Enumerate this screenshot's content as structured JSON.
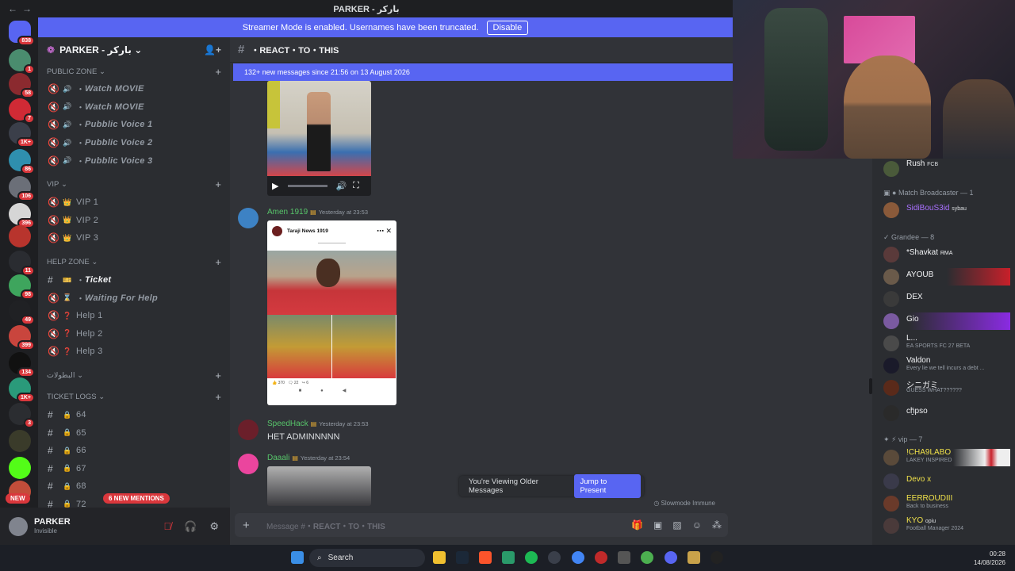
{
  "window": {
    "title": "PARKER - باركر"
  },
  "streamer": {
    "text": "Streamer Mode is enabled. Usernames have been truncated.",
    "disable_label": "Disable"
  },
  "servers": {
    "badges": [
      "838",
      "1",
      "58",
      "7",
      "1K+",
      "86",
      "106",
      "396",
      "11",
      "98",
      "49",
      "399",
      "134",
      "1K+",
      "3"
    ],
    "new_label": "NEW"
  },
  "guild": {
    "name": "PARKER - باركر"
  },
  "categories": {
    "public": "PUBLIC ZONE",
    "vip": "VIP",
    "help": "HELP ZONE",
    "arabic": "البطولات",
    "logs": "TICKET LOGS"
  },
  "public_channels": [
    {
      "emoji": "🔊",
      "name": "Watch MOVIE"
    },
    {
      "emoji": "🔊",
      "name": "Watch MOVIE"
    },
    {
      "emoji": "🔊",
      "name": "Pubblic Voice 1"
    },
    {
      "emoji": "🔊",
      "name": "Pubblic Voice 2"
    },
    {
      "emoji": "🔊",
      "name": "Pubblic Voice 3"
    }
  ],
  "vip_channels": [
    {
      "emoji": "👑",
      "name": "VIP 1"
    },
    {
      "emoji": "👑",
      "name": "VIP 2"
    },
    {
      "emoji": "👑",
      "name": "VIP 3"
    }
  ],
  "help_channels": [
    {
      "emoji": "🎫",
      "name": "Ticket"
    },
    {
      "emoji": "⌛",
      "name": "Waiting For Help"
    },
    {
      "emoji": "❓",
      "name": "Help 1"
    },
    {
      "emoji": "❓",
      "name": "Help 2"
    },
    {
      "emoji": "❓",
      "name": "Help 3"
    }
  ],
  "log_channels": [
    "64",
    "65",
    "66",
    "67",
    "68",
    "72"
  ],
  "mentions_label": "6 NEW MENTIONS",
  "user": {
    "name": "PARKER",
    "status": "Invisible"
  },
  "chat": {
    "channel": "・REACT・TO・THIS",
    "new_messages": "132+ new messages since 21:56 on 13 August 2026",
    "messages": [
      {
        "author": "Amen 1919",
        "time": "Yesterday at 23:53",
        "text": ""
      },
      {
        "author": "SpeedHack",
        "time": "Yesterday at 23:53",
        "text": "HET ADMINNNNN"
      },
      {
        "author": "Daaali",
        "time": "Yesterday at 23:54",
        "text": ""
      }
    ],
    "post": {
      "page": "Taraji News 1919",
      "likes": "370",
      "comments": "22",
      "shares": "6"
    },
    "older_text": "You're Viewing Older Messages",
    "jump_label": "Jump to Present",
    "slowmode": "Slowmode Immune",
    "composer_prefix": "Message #",
    "composer_channel": "・REACT・TO・THIS"
  },
  "members": {
    "top": {
      "name": "Rush",
      "tag": "FCB"
    },
    "group1": "Match Broadcaster — 1",
    "g1": [
      {
        "name": "SidiBouS3id",
        "tag": "sybau"
      }
    ],
    "group2": "Grandee — 8",
    "g2": [
      {
        "name": "*Shavkat",
        "tag": "RMA",
        "sub": ""
      },
      {
        "name": "AYOUB",
        "tag": "",
        "sub": ""
      },
      {
        "name": "DEX",
        "tag": "",
        "sub": ""
      },
      {
        "name": "Gio",
        "tag": "",
        "sub": ""
      },
      {
        "name": "L...",
        "tag": "",
        "sub": "EA SPORTS FC 27 BETA"
      },
      {
        "name": "Valdon",
        "tag": "",
        "sub": "Every lie we tell incurs a debt ..."
      },
      {
        "name": "シニガミ",
        "tag": "",
        "sub": "GUESS WHAT??????"
      },
      {
        "name": "cḫ̈pso",
        "tag": "",
        "sub": ""
      }
    ],
    "group3": "vip — 7",
    "g3": [
      {
        "name": "!CHA9LABO",
        "tag": "",
        "sub": "LAKEY INSPIRED"
      },
      {
        "name": "Devo x",
        "tag": "",
        "sub": ""
      },
      {
        "name": "EERROUDIII",
        "tag": "",
        "sub": "Back to business"
      },
      {
        "name": "KYO",
        "tag": "opiu",
        "sub": "Football Manager 2024"
      }
    ]
  },
  "taskbar": {
    "search": "Search",
    "time": "00:28",
    "date": "14/08/2026"
  },
  "colors": {
    "blurple": "#5865f2",
    "red": "#da373c",
    "green": "#57c46a"
  }
}
